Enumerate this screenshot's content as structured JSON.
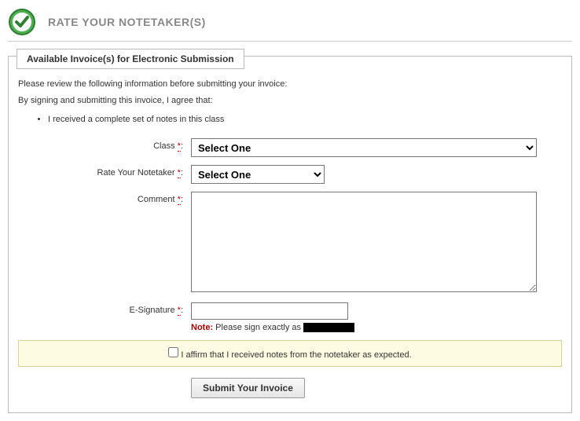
{
  "header": {
    "title": "RATE YOUR NOTETAKER(S)"
  },
  "fieldset": {
    "legend": "Available Invoice(s) for Electronic Submission",
    "intro_line1": "Please review the following information before submitting your invoice:",
    "intro_line2": "By signing and submitting this invoice, I agree that:",
    "bullet1": "I received a complete set of notes in this class"
  },
  "labels": {
    "class": "Class",
    "rating": "Rate Your Notetaker",
    "comment": "Comment",
    "esignature": "E-Signature",
    "required_mark": "*",
    "colon": ":"
  },
  "options": {
    "class_placeholder": "Select One",
    "rating_placeholder": "Select One"
  },
  "note": {
    "label": "Note:",
    "text": "Please sign exactly as"
  },
  "affirm": {
    "text": "I affirm that I received notes from the notetaker as expected."
  },
  "submit": {
    "label": "Submit Your Invoice"
  }
}
